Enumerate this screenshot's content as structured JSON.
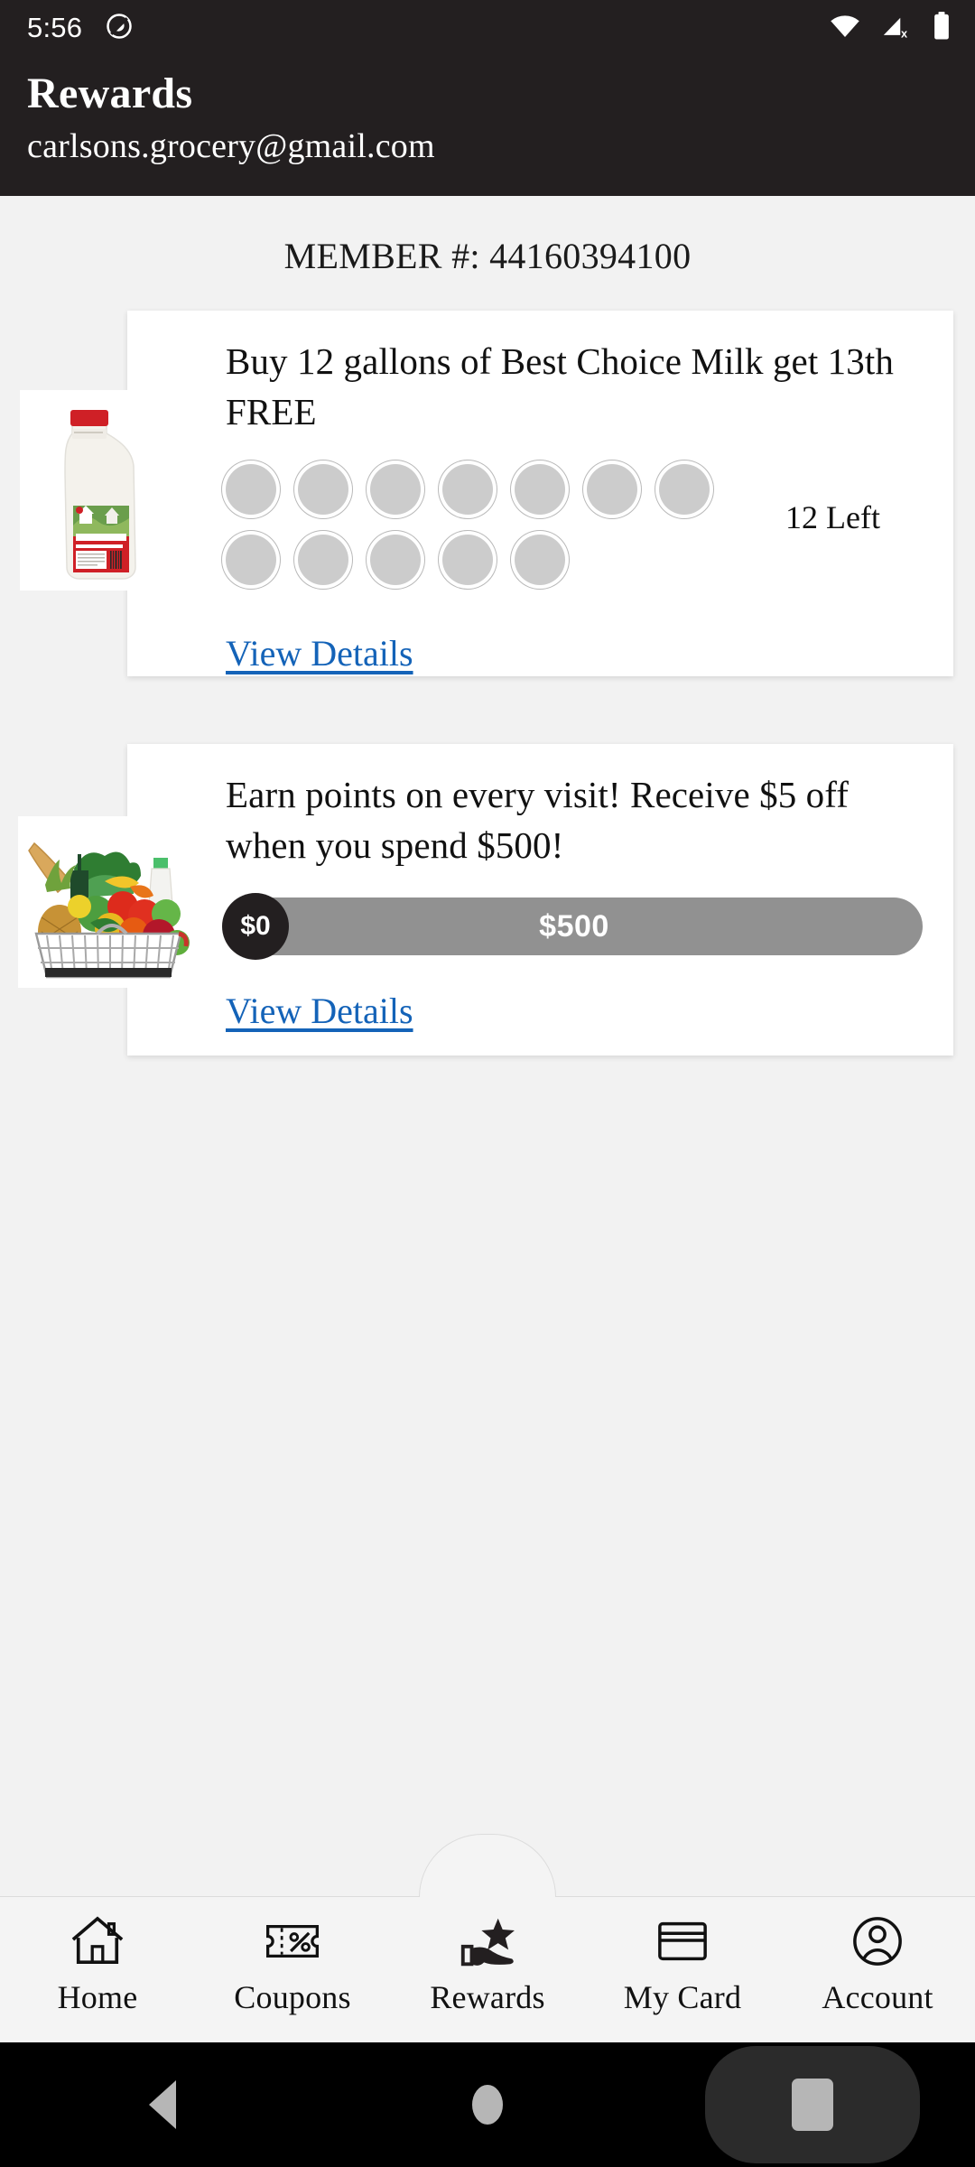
{
  "status_bar": {
    "time": "5:56",
    "icons": [
      "rotation-lock-icon",
      "wifi-icon",
      "cellular-no-sim-icon",
      "battery-icon"
    ]
  },
  "header": {
    "title": "Rewards",
    "account_email": "carlsons.grocery@gmail.com"
  },
  "member": {
    "line": "MEMBER #: 44160394100",
    "label": "MEMBER #:",
    "number": "44160394100"
  },
  "rewards": [
    {
      "id": "milk-punch-card",
      "thumbnail": "milk-gallon-image",
      "title": "Buy 12 gallons of Best Choice Milk get 13th FREE",
      "stamps_total": 12,
      "stamps_filled": 0,
      "remaining_label": "12 Left",
      "link_label": "View Details"
    },
    {
      "id": "spend-points-card",
      "thumbnail": "grocery-basket-image",
      "title": "Earn points on every visit! Receive $5 off when you spend $500!",
      "progress": {
        "current_label": "$0",
        "goal_label": "$500",
        "current_value": 0,
        "goal_value": 500,
        "percent": 0
      },
      "link_label": "View Details"
    }
  ],
  "tabbar": {
    "active": "Rewards",
    "items": [
      {
        "label": "Home",
        "icon": "house-icon"
      },
      {
        "label": "Coupons",
        "icon": "coupon-percent-icon"
      },
      {
        "label": "Rewards",
        "icon": "hand-star-icon"
      },
      {
        "label": "My Card",
        "icon": "credit-card-icon"
      },
      {
        "label": "Account",
        "icon": "person-circle-icon"
      }
    ]
  },
  "system_nav": {
    "back": "back-triangle-icon",
    "home": "home-circle-icon",
    "recents": "recents-square-icon"
  },
  "colors": {
    "header_bg": "#231f20",
    "page_bg": "#f2f2f2",
    "card_bg": "#ffffff",
    "link": "#1463b8",
    "progress_track": "#919191",
    "progress_knob": "#231f20",
    "stamp_fill": "#cccccc"
  }
}
